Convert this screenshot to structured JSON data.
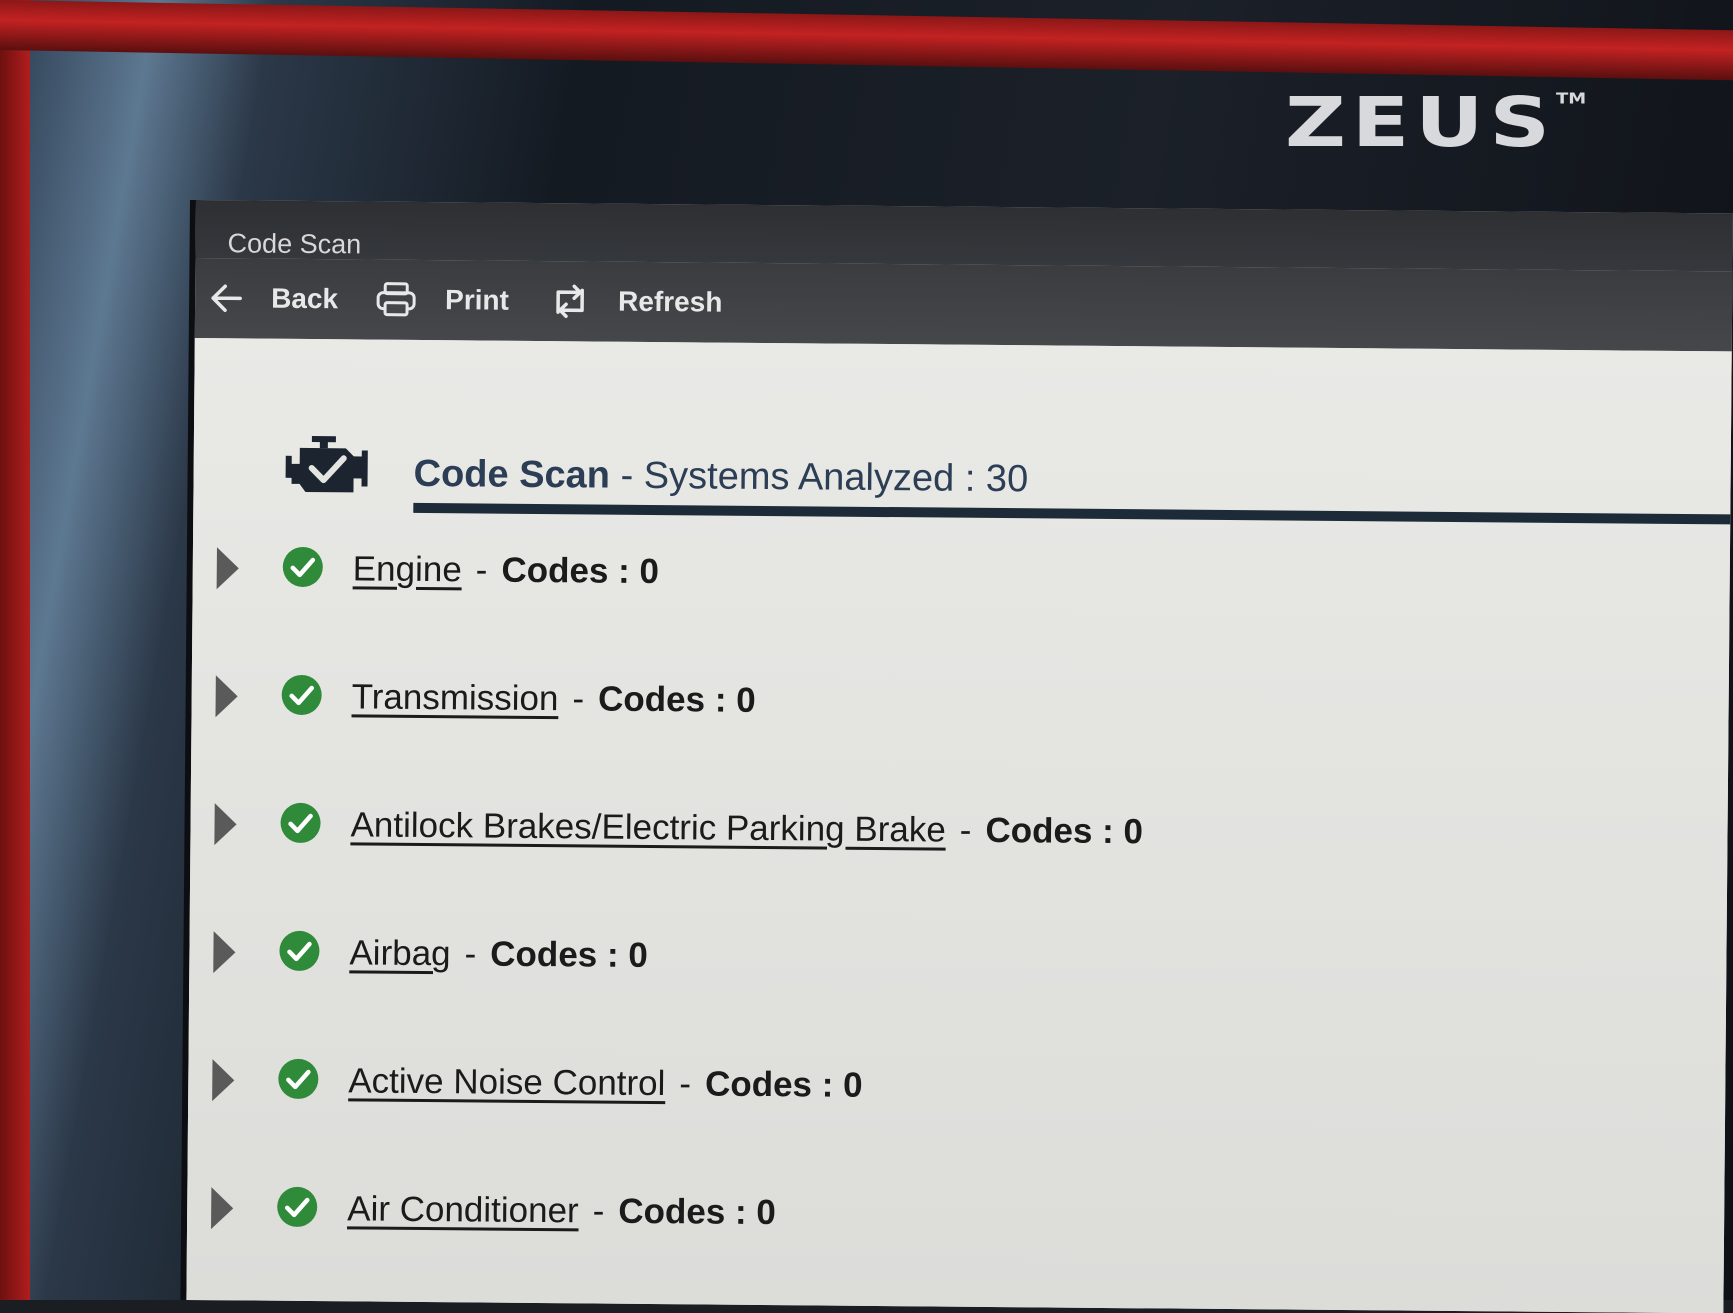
{
  "device": {
    "brand": "ZEUS",
    "trademark": "TM"
  },
  "window": {
    "title": "Code Scan"
  },
  "toolbar": {
    "back_label": "Back",
    "print_label": "Print",
    "refresh_label": "Refresh"
  },
  "heading": {
    "title": "Code Scan",
    "separator": "-",
    "subtitle": "Systems Analyzed : 30"
  },
  "systems": [
    {
      "name": "Engine",
      "separator": "-",
      "codes": "Codes : 0",
      "status": "ok"
    },
    {
      "name": "Transmission",
      "separator": "-",
      "codes": "Codes : 0",
      "status": "ok"
    },
    {
      "name": "Antilock Brakes/Electric Parking Brake",
      "separator": "-",
      "codes": "Codes : 0",
      "status": "ok"
    },
    {
      "name": "Airbag",
      "separator": "-",
      "codes": "Codes : 0",
      "status": "ok"
    },
    {
      "name": "Active Noise Control",
      "separator": "-",
      "codes": "Codes : 0",
      "status": "ok"
    },
    {
      "name": "Air Conditioner",
      "separator": "-",
      "codes": "Codes : 0",
      "status": "ok"
    }
  ],
  "colors": {
    "status_ok": "#2f8a3a",
    "heading_text": "#2c3e55",
    "toolbar_bg": "#3a3c40"
  },
  "icons": {
    "back": "arrow-left-icon",
    "print": "printer-icon",
    "refresh": "refresh-icon",
    "heading": "engine-check-icon",
    "expand": "triangle-right-icon",
    "status": "check-circle-icon"
  }
}
